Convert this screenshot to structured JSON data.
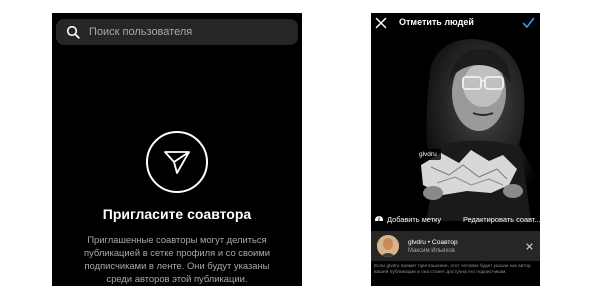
{
  "left_screen": {
    "search": {
      "placeholder": "Поиск пользователя",
      "icon": "search-icon"
    },
    "invite": {
      "icon": "paper-plane-icon",
      "title": "Пригласите соавтора",
      "description": "Приглашенные соавторы могут делиться публикацией в сетке профиля и со своими подписчиками в ленте. Они будут указаны среди авторов этой публикации."
    }
  },
  "right_screen": {
    "header": {
      "title": "Отметить людей",
      "close_icon": "close-icon",
      "done_icon": "checkmark-icon",
      "accent_color": "#3897f0"
    },
    "photo": {
      "tag_label": "glvdru",
      "info_icon_glyph": "i"
    },
    "actions": {
      "add_tag": "Добавить метку",
      "edit_coauthor": "Редактировать соавт..."
    },
    "coauthor": {
      "name_line": "glvdru • Соавтор",
      "full_name": "Максим Ильяхов",
      "remove_icon": "close-icon"
    },
    "footnote": "Если glvdru примет приглашение, этот человек будет указан как автор вашей публикации и она станет доступна его подписчикам."
  }
}
